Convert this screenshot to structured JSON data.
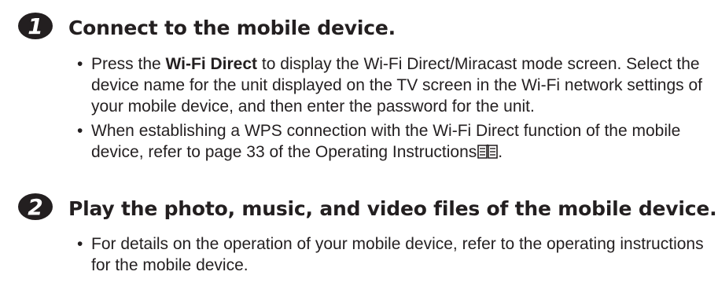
{
  "steps": [
    {
      "number": "1",
      "title": "Connect to the mobile device.",
      "bullets": [
        {
          "text_before": "Press the ",
          "bold": "Wi-Fi Direct",
          "text_after": " to display the Wi-Fi Direct/Miracast mode screen. Select the device name for the unit displayed on the TV screen in the Wi-Fi network settings of your mobile device, and then enter the password for the unit."
        },
        {
          "text": "When establishing a WPS connection with the Wi-Fi Direct function of the mobile device, refer to page 33 of the Operating Instructions",
          "icon": "book-icon",
          "end": "."
        }
      ]
    },
    {
      "number": "2",
      "title": "Play the photo, music, and video files of the mobile device.",
      "bullets": [
        {
          "text": "For details on the operation of your mobile device, refer to the operating instructions for the mobile device."
        }
      ]
    }
  ],
  "bullet_symbol": "•",
  "colors": {
    "badge_fill": "#231f20",
    "badge_text": "#ffffff",
    "text": "#231f20"
  }
}
